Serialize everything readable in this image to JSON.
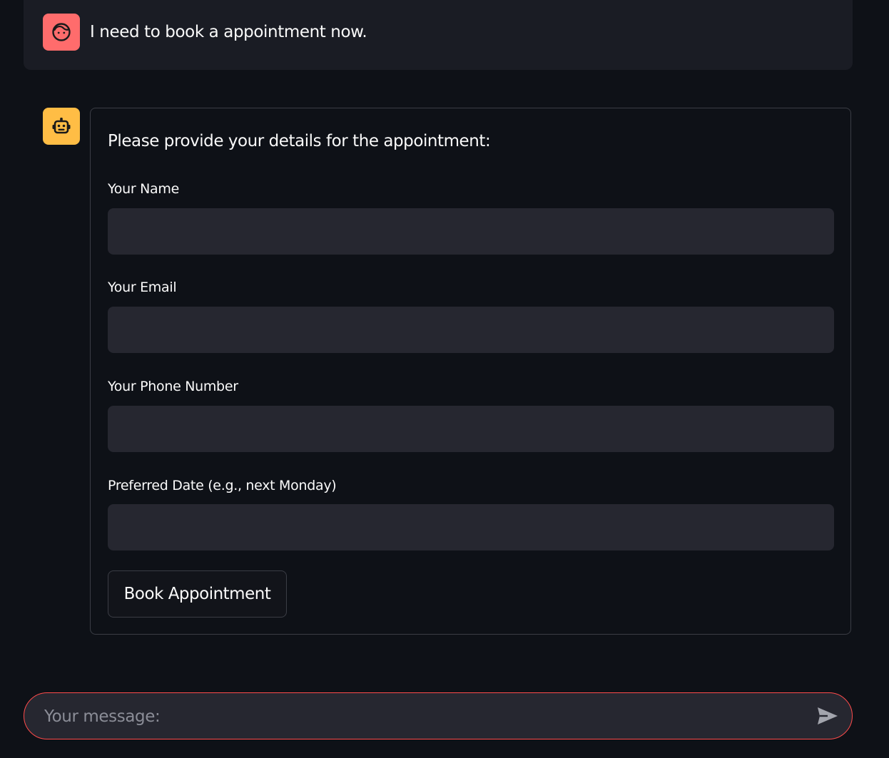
{
  "chat": {
    "user_message": "I need to book a appointment now.",
    "user_avatar_icon": "face-icon",
    "bot_avatar_icon": "robot-icon",
    "user_avatar_color": "#ff6c6c",
    "bot_avatar_color": "#ffbd45"
  },
  "form": {
    "intro": "Please provide your details for the appointment:",
    "fields": [
      {
        "label": "Your Name",
        "value": "",
        "placeholder": ""
      },
      {
        "label": "Your Email",
        "value": "",
        "placeholder": ""
      },
      {
        "label": "Your Phone Number",
        "value": "",
        "placeholder": ""
      },
      {
        "label": "Preferred Date (e.g., next Monday)",
        "value": "",
        "placeholder": ""
      }
    ],
    "submit_label": "Book Appointment"
  },
  "chat_input": {
    "placeholder": "Your message:",
    "value": "",
    "send_icon": "send-icon",
    "accent_color": "#ff4b4b"
  }
}
